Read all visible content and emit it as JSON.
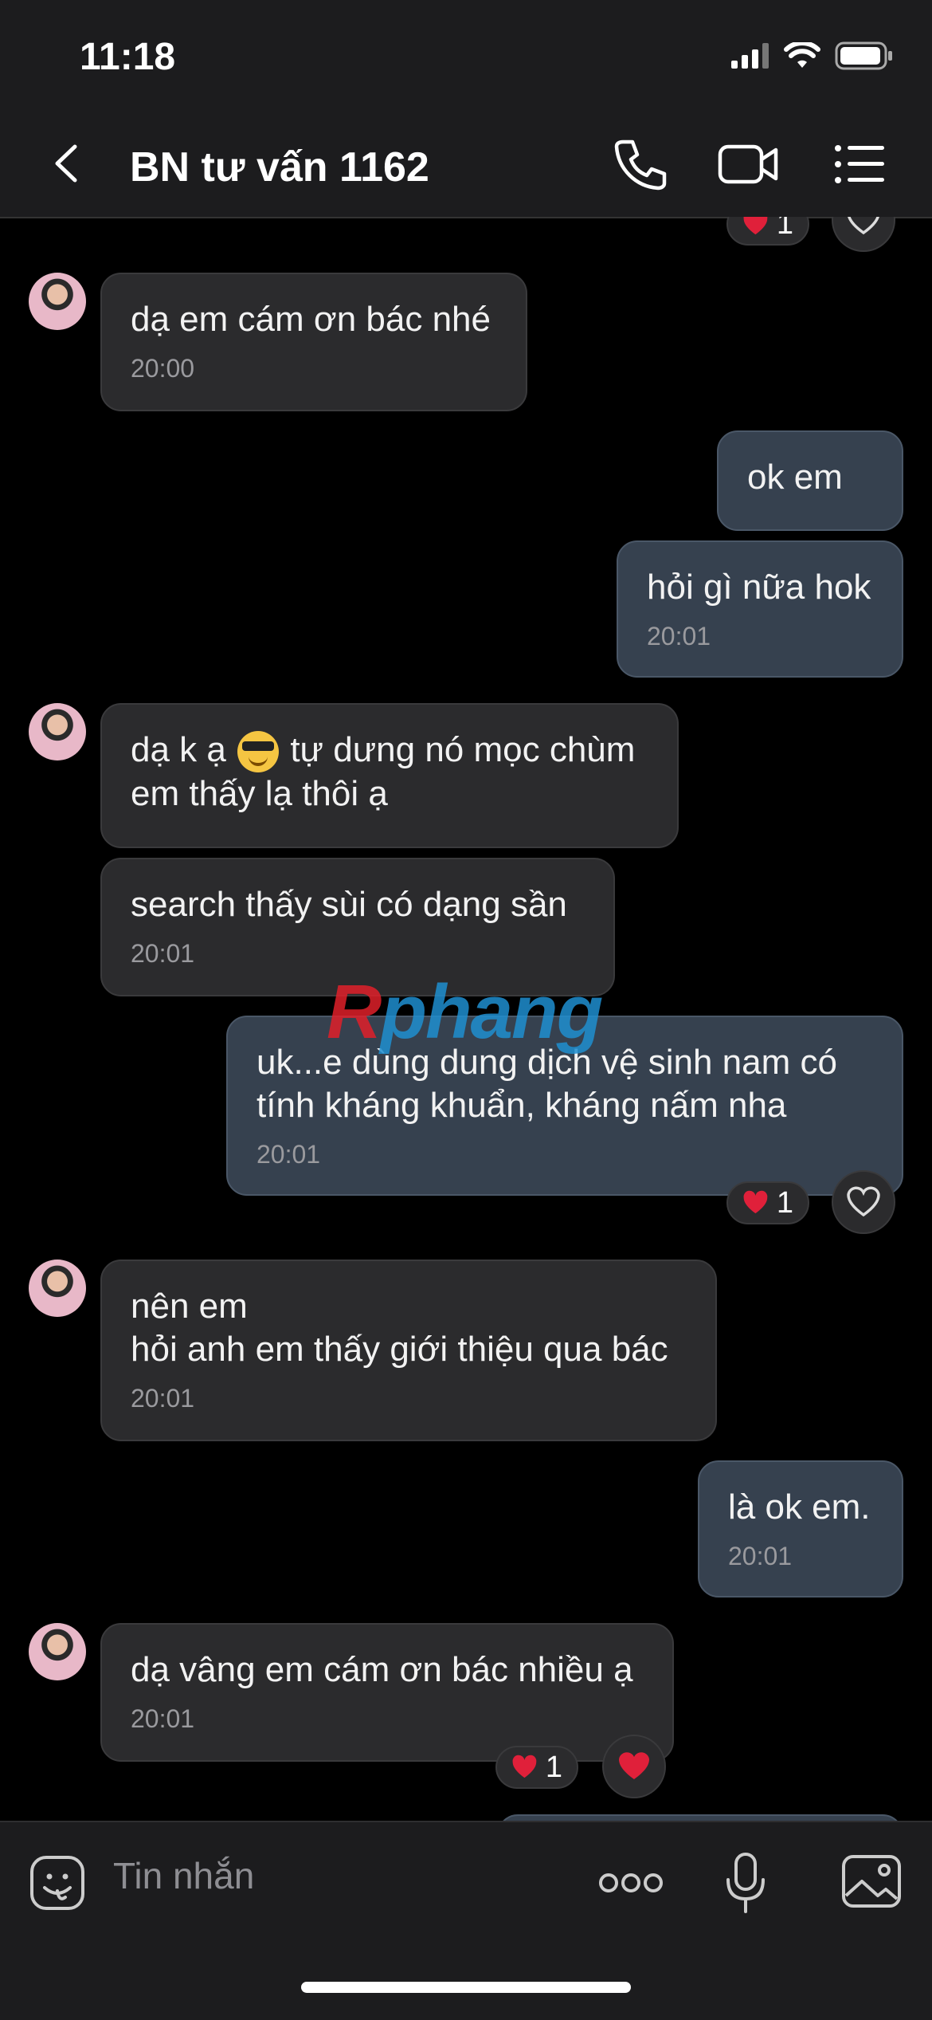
{
  "status_bar": {
    "time": "11:18"
  },
  "header": {
    "title": "BN tư vấn 1162"
  },
  "watermark": {
    "part1": "R",
    "part2": "phang"
  },
  "messages": [
    {
      "text": "dạ em cám ơn bác nhé",
      "time": "20:00"
    },
    {
      "text": "ok em"
    },
    {
      "text": "hỏi gì nữa hok",
      "time": "20:01"
    },
    {
      "text_before_emoji": "dạ k ạ ",
      "emoji": "smiling-face-with-sunglasses",
      "text_after_emoji": " tự dưng nó mọc chùm\nem thấy lạ thôi ạ"
    },
    {
      "text": "search thấy sùi có dạng sần",
      "time": "20:01"
    },
    {
      "text": "uk...e dùng dung dịch vệ sinh nam có\ntính kháng khuẩn, kháng nấm nha",
      "time": "20:01"
    },
    {
      "text": "nên em\nhỏi anh em thấy giới thiệu qua bác",
      "time": "20:01"
    },
    {
      "text": "là ok em.",
      "time": "20:01"
    },
    {
      "text": "dạ vâng em cám ơn bác nhiều ạ",
      "time": "20:01"
    }
  ],
  "reactions": {
    "top": {
      "count": "1"
    },
    "after_msg6": {
      "count": "1"
    },
    "after_msg9": {
      "count": "1"
    }
  },
  "composer": {
    "placeholder": "Tin nhắn"
  }
}
